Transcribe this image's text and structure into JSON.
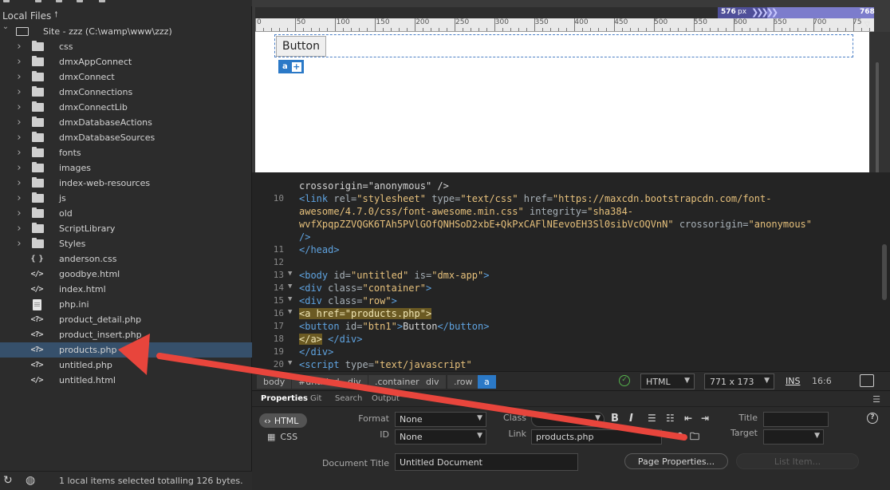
{
  "files": {
    "header": "Local Files",
    "site": "Site - zzz (C:\\wamp\\www\\zzz)",
    "folders": [
      "css",
      "dmxAppConnect",
      "dmxConnect",
      "dmxConnections",
      "dmxConnectLib",
      "dmxDatabaseActions",
      "dmxDatabaseSources",
      "fonts",
      "images",
      "index-web-resources",
      "js",
      "old",
      "ScriptLibrary",
      "Styles"
    ],
    "file_items": [
      {
        "name": "anderson.css",
        "glyph": "{ }"
      },
      {
        "name": "goodbye.html",
        "glyph": "</>"
      },
      {
        "name": "index.html",
        "glyph": "</>"
      },
      {
        "name": "php.ini",
        "glyph": "ini"
      },
      {
        "name": "product_detail.php",
        "glyph": "<?>"
      },
      {
        "name": "product_insert.php",
        "glyph": "<?>"
      },
      {
        "name": "products.php",
        "glyph": "<?>"
      },
      {
        "name": "untitled.php",
        "glyph": "<?>"
      },
      {
        "name": "untitled.html",
        "glyph": "</>"
      }
    ],
    "status": "1 local items selected totalling 126 bytes."
  },
  "design": {
    "mq_576": "576",
    "mq_px": "px",
    "mq_768": "768",
    "ruler_labels": [
      "0",
      "50",
      "100",
      "150",
      "200",
      "250",
      "300",
      "350",
      "400",
      "450",
      "500",
      "550",
      "600",
      "650",
      "700",
      "75"
    ],
    "button_text": "Button",
    "tag_label": "a",
    "tag_plus": "+"
  },
  "code": {
    "lines": [
      {
        "n": "",
        "parts": [
          [
            "tx",
            "crossorigin=\"anonymous\" />"
          ]
        ]
      },
      {
        "n": "10",
        "parts": [
          [
            "tg",
            "<link "
          ],
          [
            "at",
            "rel="
          ],
          [
            "vs",
            "\"stylesheet\" "
          ],
          [
            "at",
            "type="
          ],
          [
            "vs",
            "\"text/css\" "
          ],
          [
            "at",
            "href="
          ],
          [
            "vs",
            "\"https://maxcdn.bootstrapcdn.com/font-"
          ]
        ]
      },
      {
        "n": "",
        "parts": [
          [
            "vs",
            "awesome/4.7.0/css/font-awesome.min.css\" "
          ],
          [
            "at",
            "integrity="
          ],
          [
            "vs",
            "\"sha384-"
          ]
        ]
      },
      {
        "n": "",
        "parts": [
          [
            "vs",
            "wvfXpqpZZVQGK6TAh5PVlGOfQNHSoD2xbE+QkPxCAFlNEevoEH3Sl0sibVcOQVnN\" "
          ],
          [
            "at",
            "crossorigin="
          ],
          [
            "vs",
            "\"anonymous\""
          ]
        ]
      },
      {
        "n": "",
        "parts": [
          [
            "tg",
            "/>"
          ]
        ]
      },
      {
        "n": "11",
        "parts": [
          [
            "tg",
            "</head>"
          ]
        ]
      },
      {
        "n": "12",
        "parts": []
      },
      {
        "n": "13",
        "fold": true,
        "parts": [
          [
            "tg",
            "<body "
          ],
          [
            "at",
            "id="
          ],
          [
            "vs",
            "\"untitled\" "
          ],
          [
            "at",
            "is="
          ],
          [
            "vs",
            "\"dmx-app\""
          ],
          [
            "tg",
            ">"
          ]
        ]
      },
      {
        "n": "14",
        "fold": true,
        "parts": [
          [
            "tg",
            "<div "
          ],
          [
            "at",
            "class="
          ],
          [
            "vs",
            "\"container\""
          ],
          [
            "tg",
            ">"
          ]
        ]
      },
      {
        "n": "15",
        "fold": true,
        "parts": [
          [
            "tx",
            "  "
          ],
          [
            "tg",
            "<div "
          ],
          [
            "at",
            "class="
          ],
          [
            "vs",
            "\"row\""
          ],
          [
            "tg",
            ">"
          ]
        ]
      },
      {
        "n": "16",
        "fold": true,
        "parts": [
          [
            "tx",
            "    "
          ],
          [
            "hl",
            "<a href=\"products.php\">"
          ]
        ]
      },
      {
        "n": "17",
        "parts": [
          [
            "tx",
            "    "
          ],
          [
            "tg",
            "<button "
          ],
          [
            "at",
            "id="
          ],
          [
            "vs",
            "\"btn1\""
          ],
          [
            "tg",
            ">"
          ],
          [
            "tx",
            "Button"
          ],
          [
            "tg",
            "</button>"
          ]
        ]
      },
      {
        "n": "18",
        "parts": [
          [
            "tx",
            "  "
          ],
          [
            "hl",
            "</a>"
          ],
          [
            "tx",
            "  "
          ],
          [
            "tg",
            "</div>"
          ]
        ]
      },
      {
        "n": "19",
        "parts": [
          [
            "tg",
            "</div>"
          ]
        ]
      },
      {
        "n": "20",
        "fold": true,
        "parts": [
          [
            "tg",
            "<script "
          ],
          [
            "at",
            "type="
          ],
          [
            "vs",
            "\"text/javascript\""
          ]
        ]
      }
    ]
  },
  "tagbar": {
    "crumbs": [
      "body",
      "#untitled",
      "div",
      ".container",
      "div",
      ".row",
      "a"
    ],
    "lang": "HTML",
    "size": "771 x 173",
    "ins": "INS",
    "pos": "16:6"
  },
  "props": {
    "tabs": [
      "Properties",
      "Git",
      "Search",
      "Output"
    ],
    "html_btn": "HTML",
    "css_btn": "CSS",
    "format_label": "Format",
    "format_value": "None",
    "id_label": "ID",
    "id_value": "None",
    "class_label": "Class",
    "link_label": "Link",
    "link_value": "products.php",
    "title_label": "Title",
    "target_label": "Target",
    "doc_title_label": "Document Title",
    "doc_title_value": "Untitled Document",
    "page_props_btn": "Page Properties...",
    "list_item_btn": "List Item..."
  },
  "colors": {
    "accent": "#2b79c7",
    "arrow": "#e8453c",
    "selection": "#36506b"
  }
}
